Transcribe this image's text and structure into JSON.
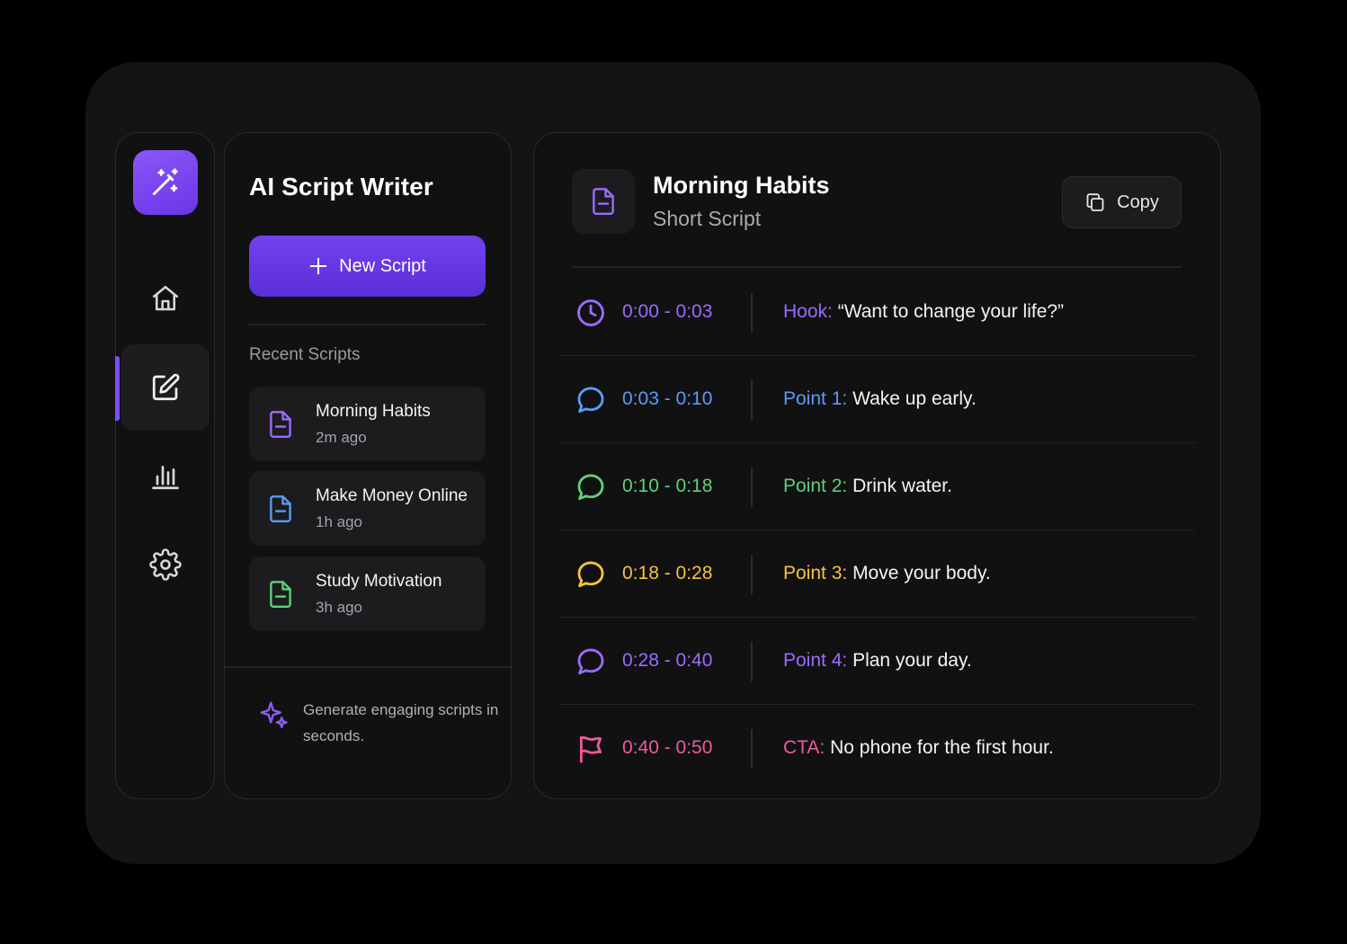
{
  "app": {
    "title": "AI Script Writer"
  },
  "sidebar": {
    "items": [
      {
        "name": "home",
        "icon": "home-icon"
      },
      {
        "name": "scripts",
        "icon": "edit-icon",
        "active": true
      },
      {
        "name": "analytics",
        "icon": "bar-chart-icon"
      },
      {
        "name": "settings",
        "icon": "gear-icon"
      }
    ]
  },
  "actions": {
    "new_script": "New Script",
    "copy": "Copy"
  },
  "recent": {
    "label": "Recent Scripts",
    "items": [
      {
        "name": "Morning Habits",
        "time": "2m ago",
        "color": "#9b6bff"
      },
      {
        "name": "Make Money Online",
        "time": "1h ago",
        "color": "#5b9cf5"
      },
      {
        "name": "Study Motivation",
        "time": "3h ago",
        "color": "#5fd07a"
      }
    ]
  },
  "tip": {
    "text": "Generate engaging scripts in seconds."
  },
  "script": {
    "title": "Morning Habits",
    "subtitle": "Short Script",
    "rows": [
      {
        "time": "0:00 - 0:03",
        "label": "Hook:",
        "text": "“Want to change your life?”",
        "color": "#9b6bff",
        "icon": "clock-icon"
      },
      {
        "time": "0:03 - 0:10",
        "label": "Point 1:",
        "text": "Wake up early.",
        "color": "#5b9cf5",
        "icon": "chat-bubble-icon"
      },
      {
        "time": "0:10 - 0:18",
        "label": "Point 2:",
        "text": "Drink water.",
        "color": "#5fd07a",
        "icon": "chat-bubble-icon"
      },
      {
        "time": "0:18 - 0:28",
        "label": "Point 3:",
        "text": "Move your body.",
        "color": "#f5c43c",
        "icon": "chat-bubble-icon"
      },
      {
        "time": "0:28 - 0:40",
        "label": "Point 4:",
        "text": "Plan your day.",
        "color": "#9b6bff",
        "icon": "chat-bubble-icon"
      },
      {
        "time": "0:40 - 0:50",
        "label": "CTA:",
        "text": "No phone for the first hour.",
        "color": "#ec5b9a",
        "icon": "flag-icon"
      }
    ]
  }
}
